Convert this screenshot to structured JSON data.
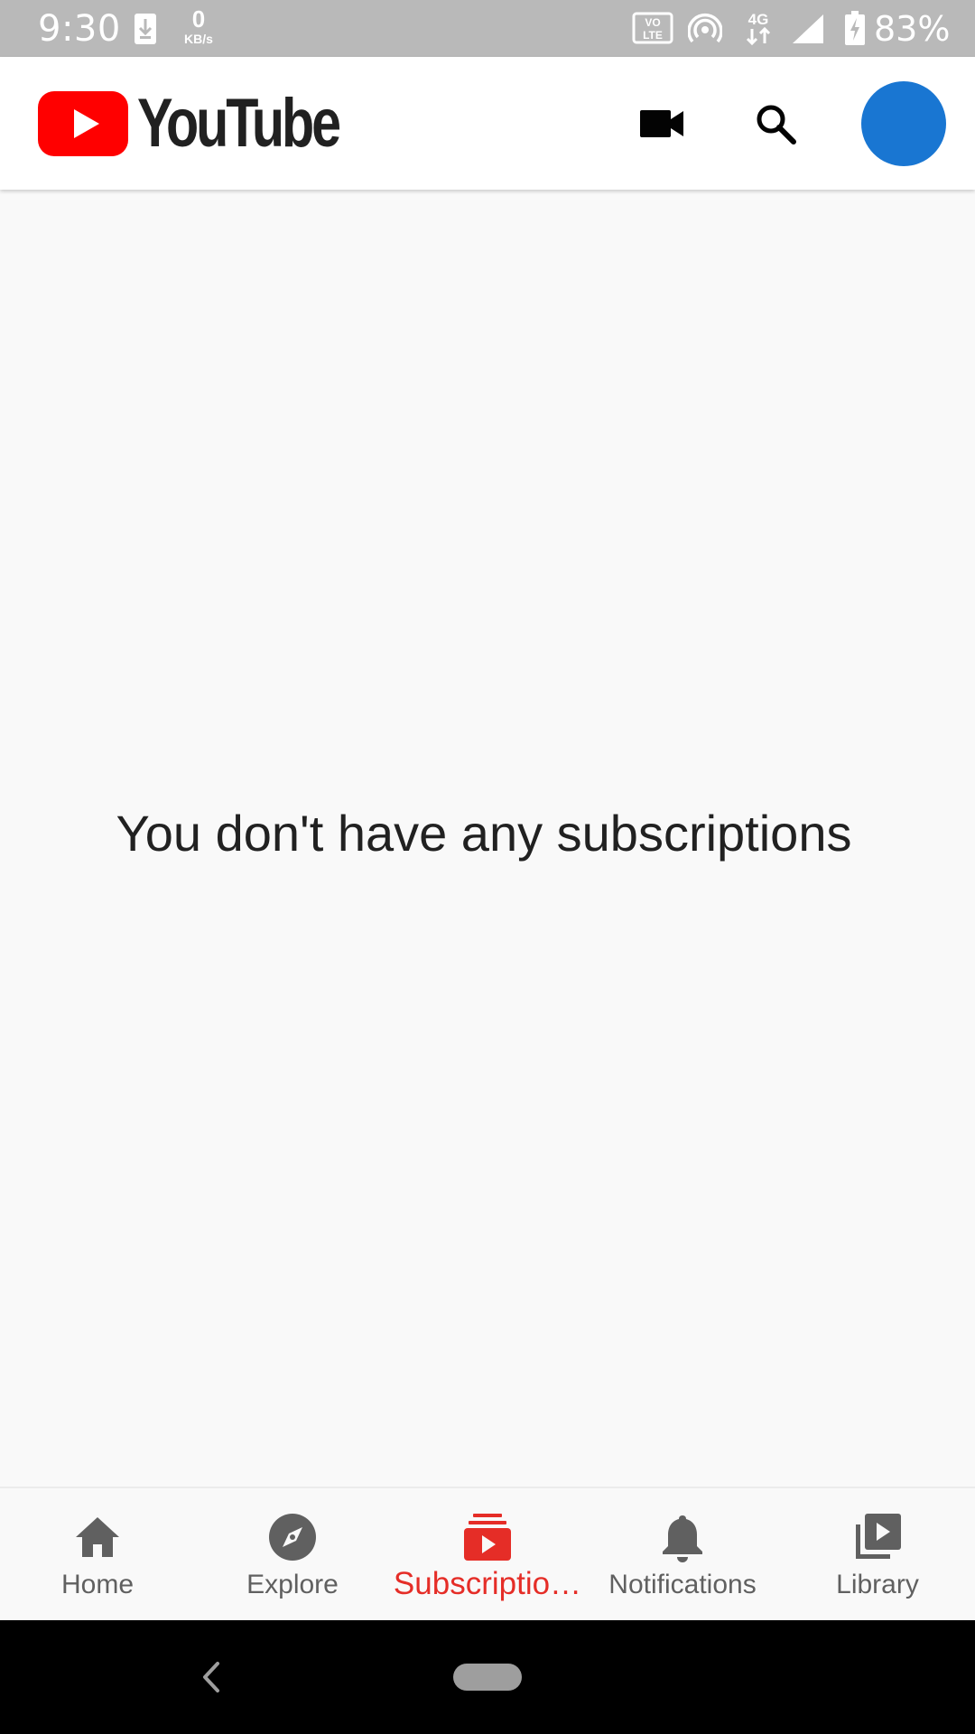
{
  "status_bar": {
    "time": "9:30",
    "net_speed_value": "0",
    "net_speed_unit": "KB/s",
    "volte_top": "VO",
    "volte_bottom": "LTE",
    "network_type": "4G",
    "battery_percent": "83%"
  },
  "app_bar": {
    "logo_text": "YouTube"
  },
  "main": {
    "empty_message": "You don't have any subscriptions"
  },
  "bottom_nav": {
    "items": [
      {
        "label": "Home",
        "icon": "home-icon"
      },
      {
        "label": "Explore",
        "icon": "explore-icon"
      },
      {
        "label": "Subscriptio…",
        "icon": "subscriptions-icon",
        "active": true
      },
      {
        "label": "Notifications",
        "icon": "bell-icon"
      },
      {
        "label": "Library",
        "icon": "library-icon"
      }
    ]
  },
  "colors": {
    "brand_red": "#ff0000",
    "active_tab": "#e52d27",
    "avatar": "#1976d2",
    "inactive_icon": "#606060"
  }
}
